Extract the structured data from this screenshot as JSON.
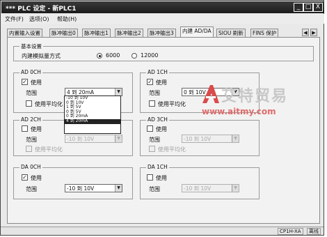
{
  "window": {
    "title": "*** PLC 设定 - 新PLC1",
    "minimize": "_",
    "maximize": "□",
    "close": "X"
  },
  "menu": [
    "文件(F)",
    "选项(O)",
    "帮助(H)"
  ],
  "tabs": [
    {
      "label": "内置输入设置",
      "active": false
    },
    {
      "label": "脉冲输出0",
      "active": false
    },
    {
      "label": "脉冲输出1",
      "active": false
    },
    {
      "label": "脉冲输出2",
      "active": false
    },
    {
      "label": "脉冲输出3",
      "active": false
    },
    {
      "label": "内建 AD/DA",
      "active": true
    },
    {
      "label": "SIOU 刷新",
      "active": false
    },
    {
      "label": "FINS 保护",
      "active": false
    }
  ],
  "tab_scroll": {
    "left": "◀",
    "right": "▶"
  },
  "basic": {
    "title": "基本设置",
    "label": "内建模拟量方式",
    "option_6000": "6000",
    "option_12000": "12000",
    "selected": "6000"
  },
  "ad0": {
    "title": "AD 0CH",
    "use_label": "使用",
    "use_checked": true,
    "range_label": "范围",
    "range_value": "4 到 20mA",
    "avg_label": "使用平均化",
    "avg_checked": false,
    "enabled": true
  },
  "ad1": {
    "title": "AD 1CH",
    "use_label": "使用",
    "use_checked": true,
    "range_label": "范围",
    "range_value": "0 到 10V",
    "avg_label": "使用平均化",
    "avg_checked": false,
    "enabled": true
  },
  "ad2": {
    "title": "AD 2CH",
    "use_label": "使用",
    "use_checked": false,
    "range_label": "范围",
    "range_value": "-10 到 10V",
    "avg_label": "使用平均化",
    "avg_checked": false,
    "enabled": false
  },
  "ad3": {
    "title": "AD 3CH",
    "use_label": "使用",
    "use_checked": false,
    "range_label": "范围",
    "range_value": "-10 到 10V",
    "avg_label": "使用平均化",
    "avg_checked": false,
    "enabled": false
  },
  "da0": {
    "title": "DA 0CH",
    "use_label": "使用",
    "use_checked": true,
    "range_label": "范围",
    "range_value": "-10 到 10V",
    "enabled": true
  },
  "da1": {
    "title": "DA 1CH",
    "use_label": "使用",
    "use_checked": false,
    "range_label": "范围",
    "range_value": "-10 到 10V",
    "enabled": false
  },
  "dropdown": {
    "options": [
      "-10 到 10V",
      "0 到 10V",
      "1 到 5V",
      "0 到 5V",
      "0 到 20mA",
      "4 到 20mA"
    ],
    "selected": "4 到 20mA"
  },
  "watermark": {
    "title": "艾特贸易",
    "url": "www.aitmy.com"
  },
  "status": {
    "model": "CP1H-XA",
    "mode": "离线"
  },
  "colors": {
    "titlebar": "#1c1c1c",
    "selection": "#222222",
    "watermark_red": "#e06a6a"
  }
}
